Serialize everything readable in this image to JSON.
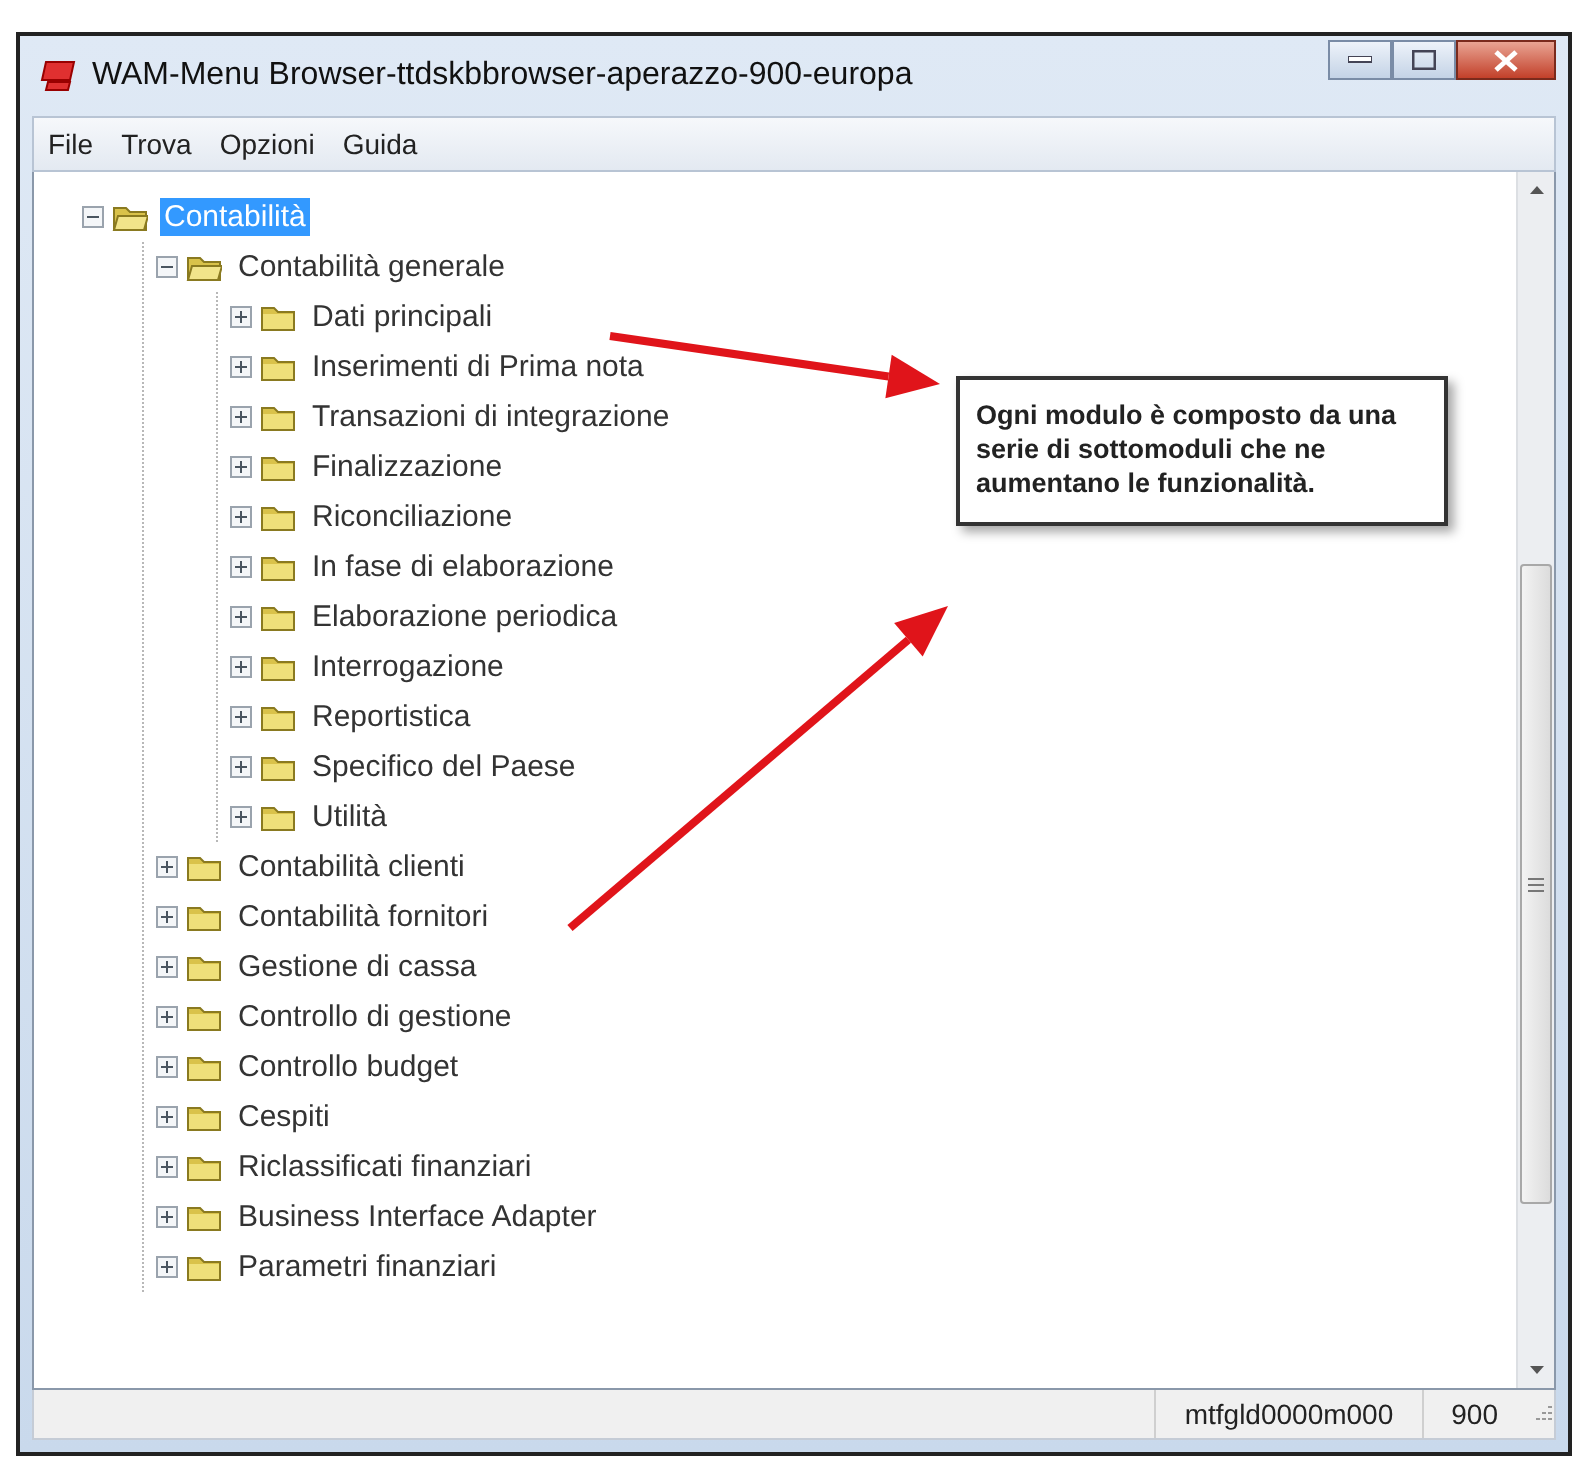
{
  "window": {
    "title": "WAM-Menu Browser-ttdskbbrowser-aperazzo-900-europa"
  },
  "menu": [
    "File",
    "Trova",
    "Opzioni",
    "Guida"
  ],
  "tree": [
    {
      "label": "Contabilità",
      "expanded": true,
      "selected": true,
      "children": [
        {
          "label": "Contabilità generale",
          "expanded": true,
          "selected": false,
          "children": [
            {
              "label": "Dati principali",
              "expanded": false,
              "selected": false
            },
            {
              "label": "Inserimenti di Prima nota",
              "expanded": false,
              "selected": false
            },
            {
              "label": "Transazioni di integrazione",
              "expanded": false,
              "selected": false
            },
            {
              "label": "Finalizzazione",
              "expanded": false,
              "selected": false
            },
            {
              "label": "Riconciliazione",
              "expanded": false,
              "selected": false
            },
            {
              "label": "In fase di elaborazione",
              "expanded": false,
              "selected": false
            },
            {
              "label": "Elaborazione periodica",
              "expanded": false,
              "selected": false
            },
            {
              "label": "Interrogazione",
              "expanded": false,
              "selected": false
            },
            {
              "label": "Reportistica",
              "expanded": false,
              "selected": false
            },
            {
              "label": "Specifico del Paese",
              "expanded": false,
              "selected": false
            },
            {
              "label": "Utilità",
              "expanded": false,
              "selected": false
            }
          ]
        },
        {
          "label": "Contabilità clienti",
          "expanded": false,
          "selected": false
        },
        {
          "label": "Contabilità fornitori",
          "expanded": false,
          "selected": false
        },
        {
          "label": "Gestione di cassa",
          "expanded": false,
          "selected": false
        },
        {
          "label": "Controllo di gestione",
          "expanded": false,
          "selected": false
        },
        {
          "label": "Controllo budget",
          "expanded": false,
          "selected": false
        },
        {
          "label": "Cespiti",
          "expanded": false,
          "selected": false
        },
        {
          "label": "Riclassificati finanziari",
          "expanded": false,
          "selected": false
        },
        {
          "label": "Business Interface Adapter",
          "expanded": false,
          "selected": false
        },
        {
          "label": "Parametri finanziari",
          "expanded": false,
          "selected": false
        }
      ]
    }
  ],
  "callout": {
    "text": "Ogni modulo è composto da una serie di sottomoduli che ne aumentano le funzionalità."
  },
  "status_bar": {
    "session": "mtfgld0000m000",
    "company": "900"
  }
}
